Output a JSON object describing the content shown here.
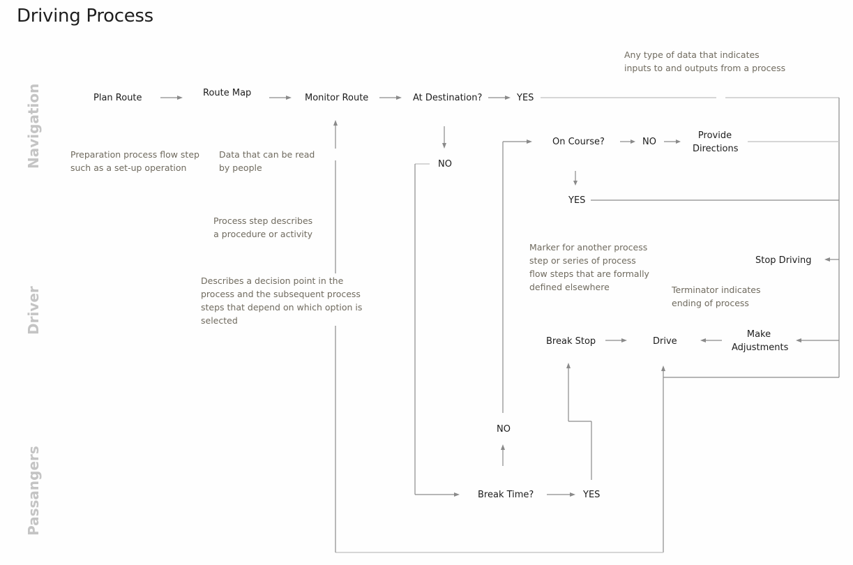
{
  "title": "Driving Process",
  "lanes": {
    "navigation": "Navigation",
    "driver": "Driver",
    "passengers": "Passangers"
  },
  "nodes": {
    "plan_route": "Plan Route",
    "route_map": "Route Map",
    "monitor_route": "Monitor Route",
    "at_destination": "At Destination?",
    "at_destination_yes": "YES",
    "at_destination_no": "NO",
    "on_course": "On Course?",
    "on_course_no": "NO",
    "on_course_yes": "YES",
    "provide_directions_line1": "Provide",
    "provide_directions_line2": "Directions",
    "stop_driving": "Stop Driving",
    "break_stop": "Break Stop",
    "drive": "Drive",
    "make_adjustments_line1": "Make",
    "make_adjustments_line2": "Adjustments",
    "break_time": "Break Time?",
    "break_time_no": "NO",
    "break_time_yes": "YES"
  },
  "notes": {
    "data_io": [
      "Any type of data that indicates",
      "inputs to and outputs from a process"
    ],
    "preparation": [
      "Preparation process flow step",
      "such as a set-up operation"
    ],
    "document": [
      "Data that can be read",
      "by people"
    ],
    "process": [
      "Process step describes",
      "a procedure or activity"
    ],
    "decision": [
      "Describes a decision point in the",
      "process and the subsequent process",
      "steps that depend on which option is",
      "selected"
    ],
    "predefined": [
      "Marker for another process",
      "step or series of process",
      "flow steps that are formally",
      "defined elsewhere"
    ],
    "terminator": [
      "Terminator indicates",
      "ending of process"
    ]
  },
  "colors": {
    "line": "#8a8a8a",
    "note_text": "#6f6a5e",
    "lane_label": "#c4c4c4",
    "node_text": "#1c1c1c"
  }
}
